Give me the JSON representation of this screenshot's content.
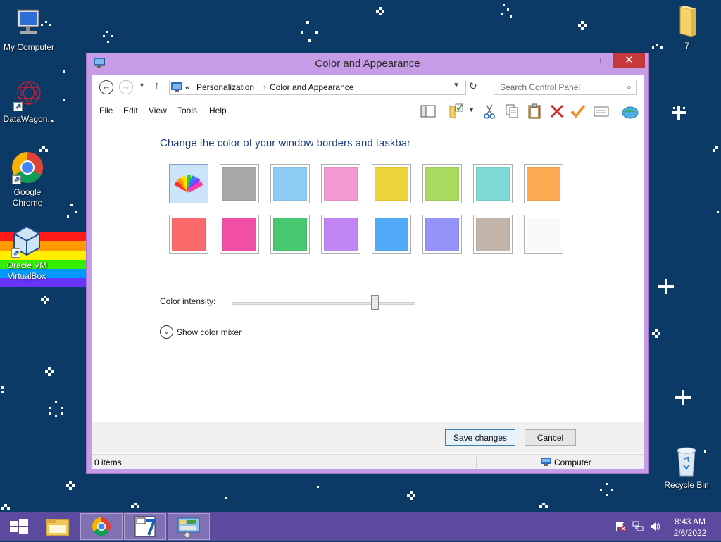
{
  "desktop": {
    "icons": [
      {
        "label": "My Computer",
        "icon": "computer-icon"
      },
      {
        "label": "DataWagon...",
        "icon": "datawagon-icon"
      },
      {
        "label": "Google Chrome",
        "icon": "chrome-icon"
      },
      {
        "label": "Oracle VM VirtualBox",
        "icon": "virtualbox-icon"
      },
      {
        "label": "7",
        "icon": "folder-icon"
      },
      {
        "label": "Recycle Bin",
        "icon": "recycle-bin-icon"
      }
    ]
  },
  "window": {
    "title": "Color and Appearance",
    "buttons": {
      "minimize": "‒",
      "maximize": "□",
      "close": "✕"
    },
    "address": {
      "prefix": "«",
      "crumbs": [
        "Personalization",
        "Color and Appearance"
      ],
      "separator": "›"
    },
    "search": {
      "placeholder": "Search Control Panel"
    },
    "menu": [
      "File",
      "Edit",
      "View",
      "Tools",
      "Help"
    ],
    "heading": "Change the color of your window borders and taskbar",
    "swatches": [
      {
        "name": "automatic",
        "color": "#5a9bd5",
        "selected": true
      },
      {
        "name": "gray",
        "color": "#a9a9a9"
      },
      {
        "name": "sky",
        "color": "#8ecbf5"
      },
      {
        "name": "pink",
        "color": "#f29ad2"
      },
      {
        "name": "yellow",
        "color": "#eed23b"
      },
      {
        "name": "lime",
        "color": "#a9d95e"
      },
      {
        "name": "teal",
        "color": "#7cd9d3"
      },
      {
        "name": "orange",
        "color": "#fdab52"
      },
      {
        "name": "red",
        "color": "#fb6b6b"
      },
      {
        "name": "magenta",
        "color": "#f14fa5"
      },
      {
        "name": "green",
        "color": "#47c870"
      },
      {
        "name": "purple",
        "color": "#c186f4"
      },
      {
        "name": "blue",
        "color": "#4fa9f6"
      },
      {
        "name": "lavender",
        "color": "#9393fa"
      },
      {
        "name": "taupe",
        "color": "#c2b4a8"
      },
      {
        "name": "white",
        "color": "#fafafa"
      }
    ],
    "intensity": {
      "label": "Color intensity:",
      "value": 0.78
    },
    "mixer_label": "Show color mixer",
    "save_label": "Save changes",
    "cancel_label": "Cancel",
    "status": {
      "items": "0 items",
      "location": "Computer"
    }
  },
  "taskbar": {
    "apps": [
      "start-icon",
      "file-explorer-icon",
      "chrome-icon",
      "seven-zip-icon",
      "control-panel-icon"
    ],
    "clock": {
      "time": "8:43 AM",
      "date": "2/6/2022"
    }
  }
}
